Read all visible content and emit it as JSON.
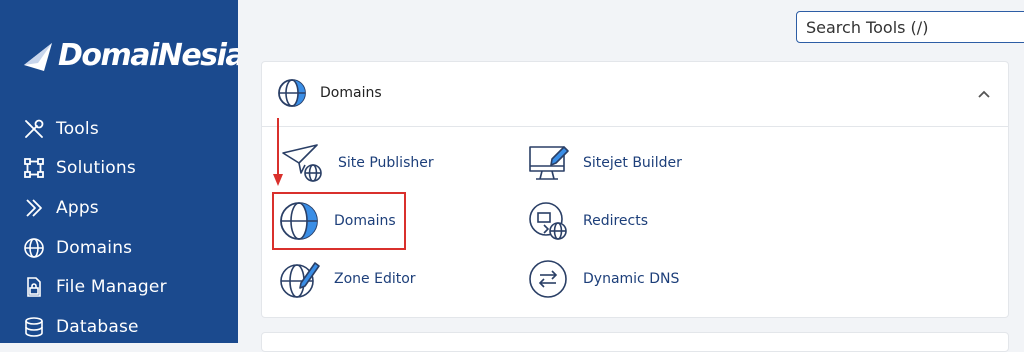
{
  "brand": {
    "name": "DomaiNesia"
  },
  "sidebar": {
    "items": [
      {
        "label": "Tools",
        "icon": "tools-icon"
      },
      {
        "label": "Solutions",
        "icon": "solutions-icon"
      },
      {
        "label": "Apps",
        "icon": "apps-icon"
      },
      {
        "label": "Domains",
        "icon": "globe-icon"
      },
      {
        "label": "File Manager",
        "icon": "file-manager-icon"
      },
      {
        "label": "Database",
        "icon": "database-icon"
      }
    ]
  },
  "search": {
    "placeholder": "Search Tools (/)"
  },
  "panel": {
    "title": "Domains",
    "tools": [
      {
        "label": "Site Publisher",
        "icon": "paper-plane-globe-icon"
      },
      {
        "label": "Sitejet Builder",
        "icon": "monitor-pencil-icon"
      },
      {
        "label": "Domains",
        "icon": "globe-icon"
      },
      {
        "label": "Redirects",
        "icon": "redirect-globe-icon"
      },
      {
        "label": "Zone Editor",
        "icon": "globe-pencil-icon"
      },
      {
        "label": "Dynamic DNS",
        "icon": "dynamic-dns-icon"
      }
    ]
  },
  "colors": {
    "sidebar": "#1b4a8e",
    "accent": "#2d5da5",
    "highlight": "#d9302c",
    "link": "#1d3f7a"
  }
}
